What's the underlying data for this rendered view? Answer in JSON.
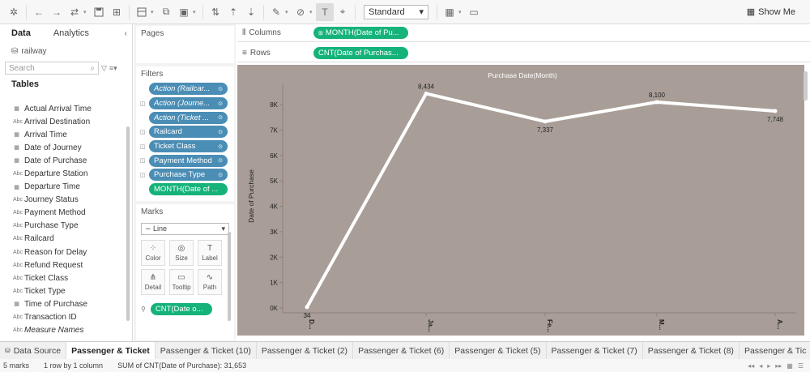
{
  "toolbar": {
    "fit_select": "Standard",
    "show_me": "Show Me"
  },
  "data_pane": {
    "tabs": [
      {
        "label": "Data",
        "active": true
      },
      {
        "label": "Analytics",
        "active": false
      }
    ],
    "collapse": "‹",
    "datasource": "railway",
    "search_placeholder": "Search",
    "tables_header": "Tables",
    "fields": [
      {
        "label": "Actual Arrival Time",
        "type": "date",
        "italic": false
      },
      {
        "label": "Arrival Destination",
        "type": "text",
        "italic": false
      },
      {
        "label": "Arrival Time",
        "type": "date",
        "italic": false
      },
      {
        "label": "Date of Journey",
        "type": "date",
        "italic": false
      },
      {
        "label": "Date of Purchase",
        "type": "date",
        "italic": false
      },
      {
        "label": "Departure Station",
        "type": "text",
        "italic": false
      },
      {
        "label": "Departure Time",
        "type": "date",
        "italic": false
      },
      {
        "label": "Journey Status",
        "type": "text",
        "italic": false
      },
      {
        "label": "Payment Method",
        "type": "text",
        "italic": false
      },
      {
        "label": "Purchase Type",
        "type": "text",
        "italic": false
      },
      {
        "label": "Railcard",
        "type": "text",
        "italic": false
      },
      {
        "label": "Reason for Delay",
        "type": "text",
        "italic": false
      },
      {
        "label": "Refund Request",
        "type": "text",
        "italic": false
      },
      {
        "label": "Ticket Class",
        "type": "text",
        "italic": false
      },
      {
        "label": "Ticket Type",
        "type": "text",
        "italic": false
      },
      {
        "label": "Time of Purchase",
        "type": "date",
        "italic": false
      },
      {
        "label": "Transaction ID",
        "type": "text",
        "italic": false
      },
      {
        "label": "Measure Names",
        "type": "text",
        "italic": true
      }
    ]
  },
  "cards": {
    "pages_title": "Pages",
    "filters_title": "Filters",
    "filters": [
      {
        "label": "Action (Railcar...",
        "italic": true,
        "color": "blue",
        "has_icon": false
      },
      {
        "label": "Action (Journe...",
        "italic": true,
        "color": "blue",
        "has_icon": true
      },
      {
        "label": "Action (Ticket ...",
        "italic": true,
        "color": "blue",
        "has_icon": false
      },
      {
        "label": "Railcard",
        "italic": false,
        "color": "blue",
        "has_icon": true
      },
      {
        "label": "Ticket Class",
        "italic": false,
        "color": "blue",
        "has_icon": true
      },
      {
        "label": "Payment Method",
        "italic": false,
        "color": "blue",
        "has_icon": true
      },
      {
        "label": "Purchase Type",
        "italic": false,
        "color": "blue",
        "has_icon": true
      },
      {
        "label": "MONTH(Date of ...",
        "italic": false,
        "color": "green",
        "has_icon": false
      }
    ],
    "marks_title": "Marks",
    "mark_type": "Line",
    "mark_buttons": [
      {
        "label": "Color",
        "icon": "color-icon"
      },
      {
        "label": "Size",
        "icon": "size-icon"
      },
      {
        "label": "Label",
        "icon": "label-icon"
      },
      {
        "label": "Detail",
        "icon": "detail-icon"
      },
      {
        "label": "Tooltip",
        "icon": "tooltip-icon"
      },
      {
        "label": "Path",
        "icon": "path-icon"
      }
    ],
    "marks_pill": "CNT(Date o..."
  },
  "shelves": {
    "columns_label": "Columns",
    "columns_pill": "MONTH(Date of Pu...",
    "rows_label": "Rows",
    "rows_pill": "CNT(Date of Purchas..."
  },
  "chart_data": {
    "type": "line",
    "title": "Purchase Date(Month)",
    "ylabel": "Date of Purchase",
    "xlabel": "",
    "categories": [
      "D...",
      "Ja...",
      "Fe...",
      "M...",
      "A..."
    ],
    "values": [
      34,
      8434,
      7337,
      8100,
      7748
    ],
    "data_labels": [
      "34",
      "8,434",
      "7,337",
      "8,100",
      "7,748"
    ],
    "y_ticks": [
      0,
      1000,
      2000,
      3000,
      4000,
      5000,
      6000,
      7000,
      8000
    ],
    "y_tick_labels": [
      "0K",
      "1K",
      "2K",
      "3K",
      "4K",
      "5K",
      "6K",
      "7K",
      "8K"
    ],
    "ylim": [
      0,
      8800
    ],
    "grid": false,
    "background": "#a89e97",
    "line_color": "#ffffff"
  },
  "sheet_tabs": [
    {
      "label": "Data Source",
      "active": false,
      "icon": true
    },
    {
      "label": "Passenger & Ticket",
      "active": true
    },
    {
      "label": "Passenger & Ticket (10)",
      "active": false
    },
    {
      "label": "Passenger & Ticket (2)",
      "active": false
    },
    {
      "label": "Passenger & Ticket (6)",
      "active": false
    },
    {
      "label": "Passenger & Ticket (5)",
      "active": false
    },
    {
      "label": "Passenger & Ticket (7)",
      "active": false
    },
    {
      "label": "Passenger & Ticket (8)",
      "active": false
    },
    {
      "label": "Passenger & Tic",
      "active": false
    }
  ],
  "status": {
    "marks": "5 marks",
    "rows_cols": "1 row by 1 column",
    "sum": "SUM of CNT(Date of Purchase): 31,653"
  },
  "colors": {
    "blue_pill": "#4a8db5",
    "green_pill": "#15b37a",
    "viz_bg": "#a89e97"
  }
}
